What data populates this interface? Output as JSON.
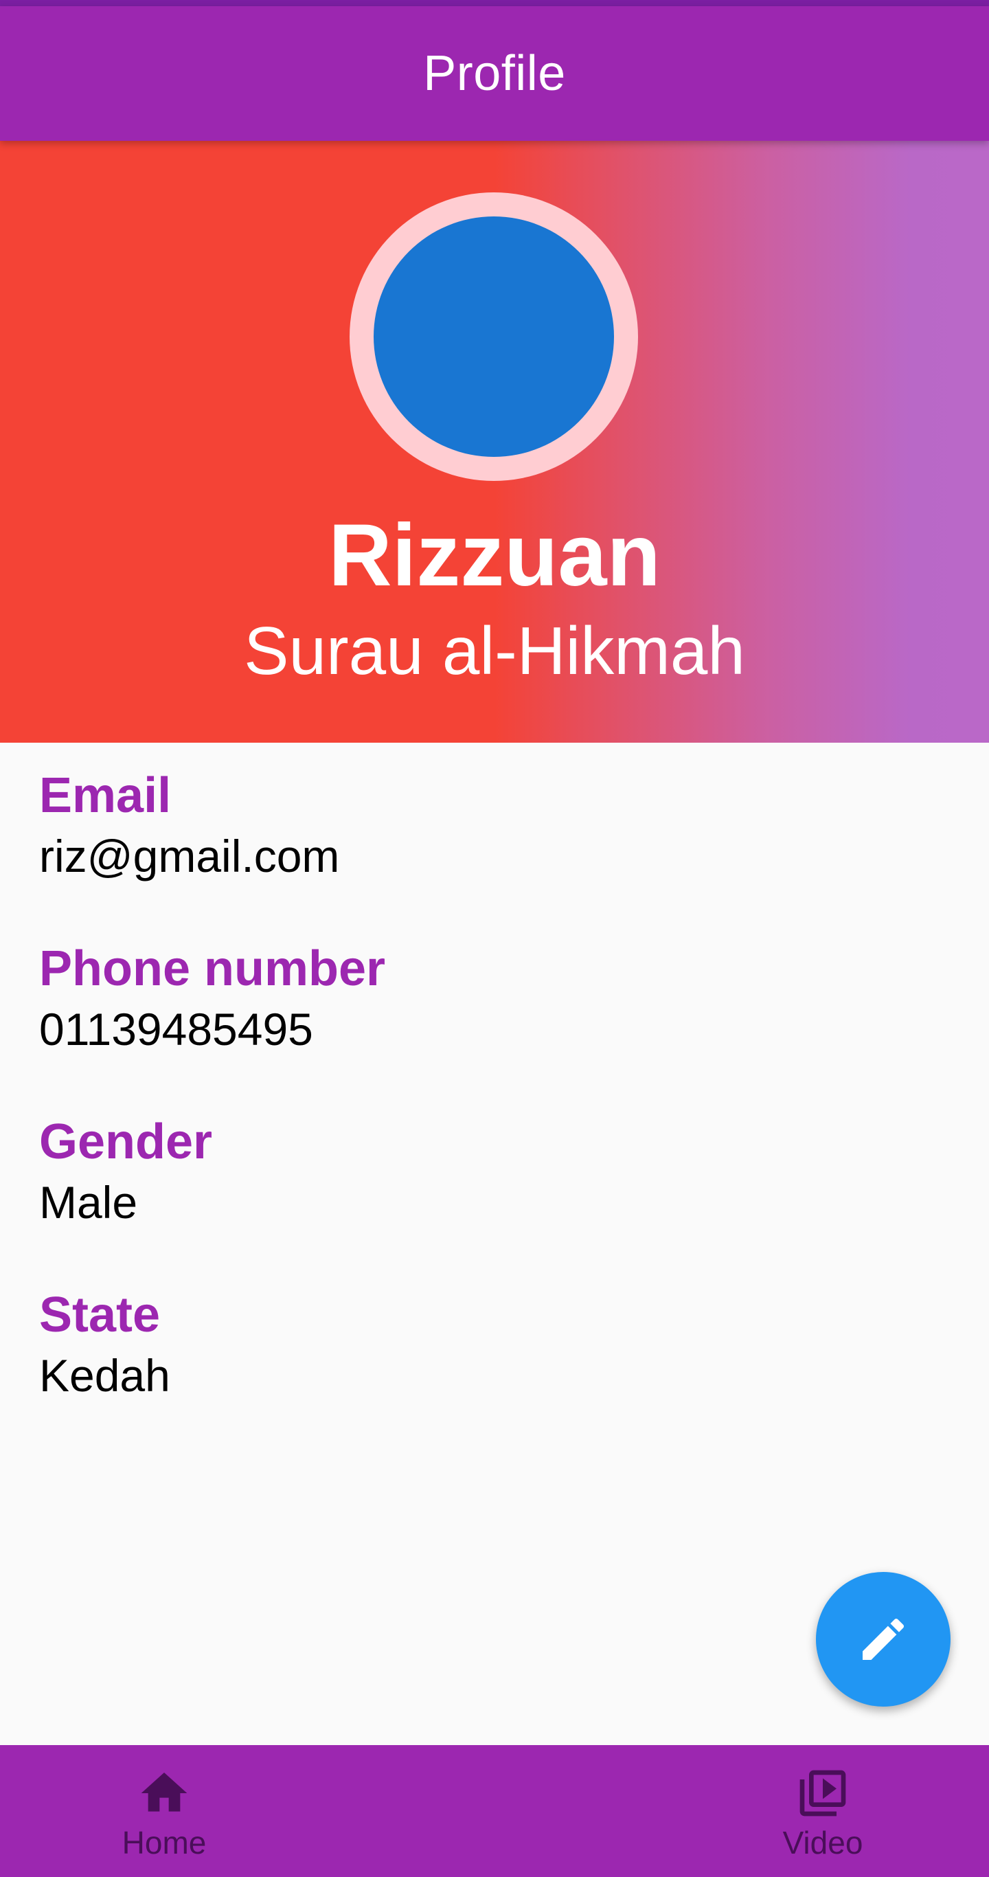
{
  "app_bar": {
    "title": "Profile"
  },
  "profile": {
    "name": "Rizzuan",
    "organization": "Surau al-Hikmah",
    "avatar_color": "#1976d2",
    "avatar_ring_color": "#ffcdd2"
  },
  "fields": [
    {
      "label": "Email",
      "value": "riz@gmail.com"
    },
    {
      "label": "Phone number",
      "value": "01139485495"
    },
    {
      "label": "Gender",
      "value": "Male"
    },
    {
      "label": "State",
      "value": "Kedah"
    }
  ],
  "fab": {
    "icon": "edit-icon",
    "color": "#2196f3"
  },
  "bottom_nav": {
    "items": [
      {
        "label": "Home",
        "icon": "home-icon"
      },
      {
        "label": "Video",
        "icon": "video-library-icon"
      }
    ]
  },
  "colors": {
    "primary": "#9c27b0",
    "status_bar": "#7b1fa2",
    "header_gradient_start": "#f44336",
    "header_gradient_end": "#ba68c8"
  }
}
